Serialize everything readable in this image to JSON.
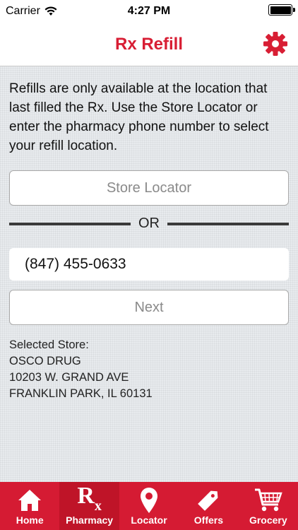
{
  "status_bar": {
    "carrier": "Carrier",
    "time": "4:27 PM",
    "battery_level": 1.0
  },
  "nav": {
    "title": "Rx Refill",
    "settings_icon": "gear-icon"
  },
  "main": {
    "intro_text": "Refills are only available at the location that last filled the Rx. Use the Store Locator or enter the pharmacy phone number to select your refill location.",
    "store_locator_label": "Store Locator",
    "divider_text": "OR",
    "phone_value": "(847) 455-0633",
    "next_label": "Next",
    "selected_store": {
      "heading": "Selected Store:",
      "name": "OSCO DRUG",
      "address": "10203 W. GRAND AVE",
      "city": "FRANKLIN PARK, IL 60131"
    }
  },
  "tabs": [
    {
      "label": "Home",
      "icon": "home-icon"
    },
    {
      "label": "Pharmacy",
      "icon": "rx-icon",
      "glyph": "R",
      "glyph_sub": "x"
    },
    {
      "label": "Locator",
      "icon": "map-pin-icon"
    },
    {
      "label": "Offers",
      "icon": "tag-icon"
    },
    {
      "label": "Grocery",
      "icon": "cart-icon"
    }
  ],
  "colors": {
    "brand_red": "#d81e34",
    "tab_bar": "#d51b33",
    "tab_active": "#bf1428",
    "background": "#e8ebee"
  }
}
